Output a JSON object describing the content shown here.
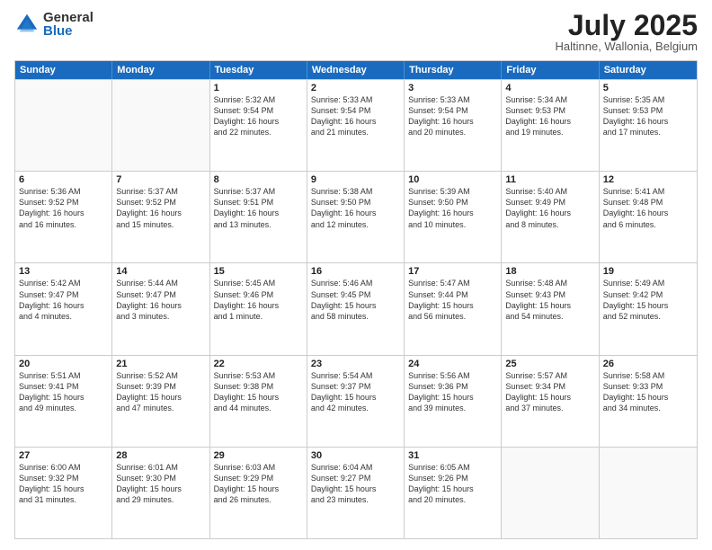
{
  "logo": {
    "general": "General",
    "blue": "Blue"
  },
  "title": "July 2025",
  "subtitle": "Haltinne, Wallonia, Belgium",
  "header_days": [
    "Sunday",
    "Monday",
    "Tuesday",
    "Wednesday",
    "Thursday",
    "Friday",
    "Saturday"
  ],
  "weeks": [
    [
      {
        "day": "",
        "lines": []
      },
      {
        "day": "",
        "lines": []
      },
      {
        "day": "1",
        "lines": [
          "Sunrise: 5:32 AM",
          "Sunset: 9:54 PM",
          "Daylight: 16 hours",
          "and 22 minutes."
        ]
      },
      {
        "day": "2",
        "lines": [
          "Sunrise: 5:33 AM",
          "Sunset: 9:54 PM",
          "Daylight: 16 hours",
          "and 21 minutes."
        ]
      },
      {
        "day": "3",
        "lines": [
          "Sunrise: 5:33 AM",
          "Sunset: 9:54 PM",
          "Daylight: 16 hours",
          "and 20 minutes."
        ]
      },
      {
        "day": "4",
        "lines": [
          "Sunrise: 5:34 AM",
          "Sunset: 9:53 PM",
          "Daylight: 16 hours",
          "and 19 minutes."
        ]
      },
      {
        "day": "5",
        "lines": [
          "Sunrise: 5:35 AM",
          "Sunset: 9:53 PM",
          "Daylight: 16 hours",
          "and 17 minutes."
        ]
      }
    ],
    [
      {
        "day": "6",
        "lines": [
          "Sunrise: 5:36 AM",
          "Sunset: 9:52 PM",
          "Daylight: 16 hours",
          "and 16 minutes."
        ]
      },
      {
        "day": "7",
        "lines": [
          "Sunrise: 5:37 AM",
          "Sunset: 9:52 PM",
          "Daylight: 16 hours",
          "and 15 minutes."
        ]
      },
      {
        "day": "8",
        "lines": [
          "Sunrise: 5:37 AM",
          "Sunset: 9:51 PM",
          "Daylight: 16 hours",
          "and 13 minutes."
        ]
      },
      {
        "day": "9",
        "lines": [
          "Sunrise: 5:38 AM",
          "Sunset: 9:50 PM",
          "Daylight: 16 hours",
          "and 12 minutes."
        ]
      },
      {
        "day": "10",
        "lines": [
          "Sunrise: 5:39 AM",
          "Sunset: 9:50 PM",
          "Daylight: 16 hours",
          "and 10 minutes."
        ]
      },
      {
        "day": "11",
        "lines": [
          "Sunrise: 5:40 AM",
          "Sunset: 9:49 PM",
          "Daylight: 16 hours",
          "and 8 minutes."
        ]
      },
      {
        "day": "12",
        "lines": [
          "Sunrise: 5:41 AM",
          "Sunset: 9:48 PM",
          "Daylight: 16 hours",
          "and 6 minutes."
        ]
      }
    ],
    [
      {
        "day": "13",
        "lines": [
          "Sunrise: 5:42 AM",
          "Sunset: 9:47 PM",
          "Daylight: 16 hours",
          "and 4 minutes."
        ]
      },
      {
        "day": "14",
        "lines": [
          "Sunrise: 5:44 AM",
          "Sunset: 9:47 PM",
          "Daylight: 16 hours",
          "and 3 minutes."
        ]
      },
      {
        "day": "15",
        "lines": [
          "Sunrise: 5:45 AM",
          "Sunset: 9:46 PM",
          "Daylight: 16 hours",
          "and 1 minute."
        ]
      },
      {
        "day": "16",
        "lines": [
          "Sunrise: 5:46 AM",
          "Sunset: 9:45 PM",
          "Daylight: 15 hours",
          "and 58 minutes."
        ]
      },
      {
        "day": "17",
        "lines": [
          "Sunrise: 5:47 AM",
          "Sunset: 9:44 PM",
          "Daylight: 15 hours",
          "and 56 minutes."
        ]
      },
      {
        "day": "18",
        "lines": [
          "Sunrise: 5:48 AM",
          "Sunset: 9:43 PM",
          "Daylight: 15 hours",
          "and 54 minutes."
        ]
      },
      {
        "day": "19",
        "lines": [
          "Sunrise: 5:49 AM",
          "Sunset: 9:42 PM",
          "Daylight: 15 hours",
          "and 52 minutes."
        ]
      }
    ],
    [
      {
        "day": "20",
        "lines": [
          "Sunrise: 5:51 AM",
          "Sunset: 9:41 PM",
          "Daylight: 15 hours",
          "and 49 minutes."
        ]
      },
      {
        "day": "21",
        "lines": [
          "Sunrise: 5:52 AM",
          "Sunset: 9:39 PM",
          "Daylight: 15 hours",
          "and 47 minutes."
        ]
      },
      {
        "day": "22",
        "lines": [
          "Sunrise: 5:53 AM",
          "Sunset: 9:38 PM",
          "Daylight: 15 hours",
          "and 44 minutes."
        ]
      },
      {
        "day": "23",
        "lines": [
          "Sunrise: 5:54 AM",
          "Sunset: 9:37 PM",
          "Daylight: 15 hours",
          "and 42 minutes."
        ]
      },
      {
        "day": "24",
        "lines": [
          "Sunrise: 5:56 AM",
          "Sunset: 9:36 PM",
          "Daylight: 15 hours",
          "and 39 minutes."
        ]
      },
      {
        "day": "25",
        "lines": [
          "Sunrise: 5:57 AM",
          "Sunset: 9:34 PM",
          "Daylight: 15 hours",
          "and 37 minutes."
        ]
      },
      {
        "day": "26",
        "lines": [
          "Sunrise: 5:58 AM",
          "Sunset: 9:33 PM",
          "Daylight: 15 hours",
          "and 34 minutes."
        ]
      }
    ],
    [
      {
        "day": "27",
        "lines": [
          "Sunrise: 6:00 AM",
          "Sunset: 9:32 PM",
          "Daylight: 15 hours",
          "and 31 minutes."
        ]
      },
      {
        "day": "28",
        "lines": [
          "Sunrise: 6:01 AM",
          "Sunset: 9:30 PM",
          "Daylight: 15 hours",
          "and 29 minutes."
        ]
      },
      {
        "day": "29",
        "lines": [
          "Sunrise: 6:03 AM",
          "Sunset: 9:29 PM",
          "Daylight: 15 hours",
          "and 26 minutes."
        ]
      },
      {
        "day": "30",
        "lines": [
          "Sunrise: 6:04 AM",
          "Sunset: 9:27 PM",
          "Daylight: 15 hours",
          "and 23 minutes."
        ]
      },
      {
        "day": "31",
        "lines": [
          "Sunrise: 6:05 AM",
          "Sunset: 9:26 PM",
          "Daylight: 15 hours",
          "and 20 minutes."
        ]
      },
      {
        "day": "",
        "lines": []
      },
      {
        "day": "",
        "lines": []
      }
    ]
  ]
}
